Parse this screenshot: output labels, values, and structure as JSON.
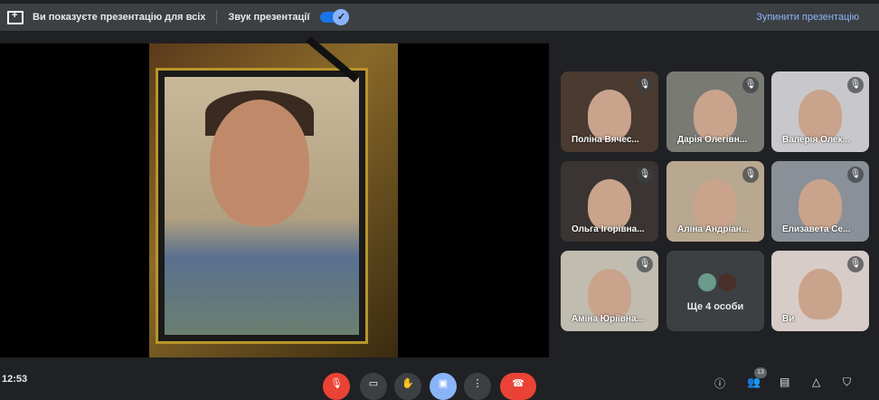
{
  "topbar": {
    "presenting_text": "Ви показуєте презентацію для всіх",
    "sound_label": "Звук презентації",
    "sound_enabled": true,
    "stop_label": "Зупинити презентацію"
  },
  "participants": [
    {
      "name": "Поліна Вячес...",
      "muted": true
    },
    {
      "name": "Дарія Олегівн...",
      "muted": true
    },
    {
      "name": "Валерія Олек...",
      "muted": true
    },
    {
      "name": "Ольга Ігорівна...",
      "muted": true
    },
    {
      "name": "Аліна Андріан...",
      "muted": true
    },
    {
      "name": "Елизавета Се...",
      "muted": true
    },
    {
      "name": "Аміна Юріївна...",
      "muted": true
    },
    {
      "name": "Ви",
      "muted": true
    }
  ],
  "more": {
    "label": "Ще 4 особи"
  },
  "bottom": {
    "time": "12:53",
    "participants_count": "13"
  },
  "colors": {
    "accent": "#8ab4f8",
    "end_call": "#ea4335",
    "bg": "#202124"
  }
}
